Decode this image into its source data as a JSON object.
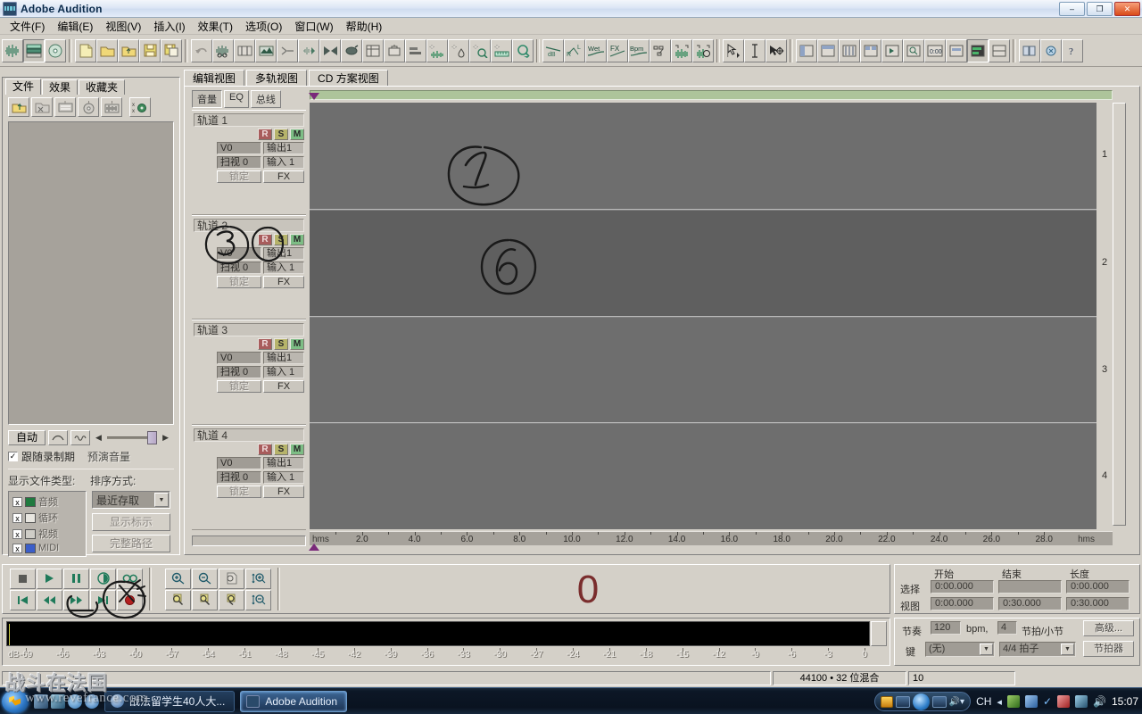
{
  "window": {
    "title": "Adobe Audition",
    "icon": "audition-icon",
    "minimize_label": "–",
    "maximize_label": "❐",
    "close_label": "✕"
  },
  "menubar": {
    "items": [
      {
        "label": "文件(F)",
        "name": "menu-file"
      },
      {
        "label": "编辑(E)",
        "name": "menu-edit"
      },
      {
        "label": "视图(V)",
        "name": "menu-view"
      },
      {
        "label": "插入(I)",
        "name": "menu-insert"
      },
      {
        "label": "效果(T)",
        "name": "menu-effects"
      },
      {
        "label": "选项(O)",
        "name": "menu-options"
      },
      {
        "label": "窗口(W)",
        "name": "menu-window"
      },
      {
        "label": "帮助(H)",
        "name": "menu-help"
      }
    ]
  },
  "toolbar": {
    "groups": [
      {
        "name": "view-mode",
        "buttons": [
          {
            "name": "edit-view-icon",
            "glyph": "wave"
          },
          {
            "name": "multitrack-view-icon",
            "glyph": "tracks",
            "pressed": true
          },
          {
            "name": "cd-view-icon",
            "glyph": "disc"
          }
        ]
      },
      {
        "name": "file-ops",
        "buttons": [
          {
            "name": "new-file-icon",
            "glyph": "page"
          },
          {
            "name": "open-file-icon",
            "glyph": "folder"
          },
          {
            "name": "save-as-icon",
            "glyph": "folder-up"
          },
          {
            "name": "save-icon",
            "glyph": "floppy"
          },
          {
            "name": "save-all-icon",
            "glyph": "floppy-plus"
          }
        ]
      },
      {
        "name": "edit-ops",
        "buttons": [
          {
            "name": "undo-icon",
            "glyph": "undo"
          },
          {
            "name": "cut-icon",
            "glyph": "scissors-wave"
          },
          {
            "name": "trim-icon",
            "glyph": "trim"
          },
          {
            "name": "mix-paste-icon",
            "glyph": "mixpaste"
          },
          {
            "name": "delete-silence-icon",
            "glyph": "cutmark"
          },
          {
            "name": "fade-icon",
            "glyph": "fade"
          },
          {
            "name": "reverse-icon",
            "glyph": "bowtie"
          },
          {
            "name": "normalize-icon",
            "glyph": "ellipse"
          },
          {
            "name": "group-waveform-icon",
            "glyph": "grid"
          },
          {
            "name": "envelope-icon",
            "glyph": "env"
          },
          {
            "name": "align-icon",
            "glyph": "align"
          }
        ]
      },
      {
        "name": "auto-ops",
        "buttons": [
          {
            "name": "auto-cue-icon",
            "glyph": "star-wave"
          },
          {
            "name": "auto-drop-icon",
            "glyph": "star-drop"
          },
          {
            "name": "auto-find-icon",
            "glyph": "star-find"
          },
          {
            "name": "auto-scale-icon",
            "glyph": "star-ruler"
          },
          {
            "name": "auto-scan-icon",
            "glyph": "magnify"
          }
        ]
      },
      {
        "name": "envelope-ops",
        "buttons": [
          {
            "name": "volume-envelope-icon",
            "glyph": "dB"
          },
          {
            "name": "pan-envelope-icon",
            "glyph": "RL"
          },
          {
            "name": "wet-envelope-icon",
            "glyph": "Wet"
          },
          {
            "name": "fx-envelope-icon",
            "glyph": "FX"
          },
          {
            "name": "tempo-envelope-icon",
            "glyph": "Bpm"
          }
        ]
      },
      {
        "name": "clip-ops",
        "buttons": [
          {
            "name": "clip-edge-icon",
            "glyph": "boxes"
          },
          {
            "name": "lock-time-icon",
            "glyph": "lock-wave"
          },
          {
            "name": "loop-clip-icon",
            "glyph": "loop-wave"
          }
        ]
      },
      {
        "name": "tools",
        "buttons": [
          {
            "name": "hybrid-tool-icon",
            "glyph": "arrow-i"
          },
          {
            "name": "time-select-tool-icon",
            "glyph": "ibeam"
          },
          {
            "name": "move-copy-tool-icon",
            "glyph": "move"
          }
        ]
      },
      {
        "name": "panels",
        "buttons": [
          {
            "name": "show-files-panel-icon",
            "glyph": "panel1"
          },
          {
            "name": "show-effects-panel-icon",
            "glyph": "panel2"
          },
          {
            "name": "show-mixer-panel-icon",
            "glyph": "panel3"
          },
          {
            "name": "show-organizer-icon",
            "glyph": "panel4"
          },
          {
            "name": "show-transport-icon",
            "glyph": "panel5"
          },
          {
            "name": "show-zoom-icon",
            "glyph": "panel6"
          },
          {
            "name": "show-time-icon",
            "glyph": "panel7"
          },
          {
            "name": "show-selection-icon",
            "glyph": "panel8"
          },
          {
            "name": "show-level-meters-icon",
            "glyph": "panel9",
            "pressed": true
          },
          {
            "name": "show-placekeeper-icon",
            "glyph": "panel10"
          }
        ]
      },
      {
        "name": "help",
        "buttons": [
          {
            "name": "workspace-icon",
            "glyph": "ws"
          },
          {
            "name": "about-icon",
            "glyph": "abt"
          },
          {
            "name": "help-icon",
            "glyph": "?"
          }
        ]
      }
    ]
  },
  "files_panel": {
    "tabs": [
      {
        "label": "文件",
        "name": "tab-files",
        "active": true
      },
      {
        "label": "效果",
        "name": "tab-effects",
        "active": false
      },
      {
        "label": "收藏夹",
        "name": "tab-favorites",
        "active": false
      }
    ],
    "toolbar_buttons": [
      {
        "name": "import-file-icon",
        "glyph": "import"
      },
      {
        "name": "close-file-icon",
        "glyph": "close-folder"
      },
      {
        "name": "insert-multitrack-icon",
        "glyph": "insert"
      },
      {
        "name": "insert-cd-icon",
        "glyph": "cd"
      },
      {
        "name": "edit-file-icon",
        "glyph": "edit-wave"
      },
      {
        "name": "file-options-icon",
        "glyph": "options"
      }
    ],
    "auto_button": "自动",
    "loop_button_name": "loop-play-button",
    "play_button_name": "play-preview-button",
    "preview_volume_label": "预演音量",
    "follow_record_label": "跟随录制期",
    "follow_record_checked": true,
    "show_types_label": "显示文件类型:",
    "sort_by_label": "排序方式:",
    "sort_value": "最近存取",
    "file_types": [
      {
        "label": "音频",
        "checked": true,
        "color": "#2fa84f",
        "name": "filetype-audio"
      },
      {
        "label": "循环",
        "checked": true,
        "color": "#e8e6e0",
        "name": "filetype-loop"
      },
      {
        "label": "视频",
        "checked": true,
        "color": "#cfcdc7",
        "name": "filetype-video"
      },
      {
        "label": "MIDI",
        "checked": true,
        "color": "#3b5ec9",
        "name": "filetype-midi"
      }
    ],
    "show_cues_button": "显示标示",
    "full_path_button": "完整路径"
  },
  "multitrack": {
    "tabs": [
      {
        "label": "编辑视图",
        "name": "tab-edit-view",
        "active": false
      },
      {
        "label": "多轨视图",
        "name": "tab-multitrack-view",
        "active": true
      },
      {
        "label": "CD 方案视图",
        "name": "tab-cd-view",
        "active": false
      }
    ],
    "view_buttons": [
      {
        "label": "音量",
        "name": "btn-volume-view",
        "pressed": true
      },
      {
        "label": "EQ",
        "name": "btn-eq-view",
        "pressed": false
      },
      {
        "label": "总线",
        "name": "btn-bus-view",
        "pressed": false
      }
    ],
    "track_control_labels": {
      "record": "R",
      "solo": "S",
      "mute": "M",
      "volume": "V0",
      "output": "输出1",
      "pan": "扫视 0",
      "input": "输入 1",
      "lock": "锁定",
      "fx": "FX"
    },
    "tracks": [
      {
        "name": "轨道 1",
        "number": "1"
      },
      {
        "name": "轨道 2",
        "number": "2"
      },
      {
        "name": "轨道 3",
        "number": "3"
      },
      {
        "name": "轨道 4",
        "number": "4"
      }
    ],
    "ruler": {
      "unit_left": "hms",
      "unit_right": "hms",
      "labels": [
        "2.0",
        "4.0",
        "6.0",
        "8.0",
        "10.0",
        "12.0",
        "14.0",
        "16.0",
        "18.0",
        "20.0",
        "22.0",
        "24.0",
        "26.0",
        "28.0"
      ]
    }
  },
  "transport": {
    "top_row": [
      {
        "name": "stop-button",
        "glyph": "stop"
      },
      {
        "name": "play-button",
        "glyph": "play"
      },
      {
        "name": "pause-button",
        "glyph": "pause"
      },
      {
        "name": "play-from-cursor-button",
        "glyph": "playcircle"
      },
      {
        "name": "loop-play-button",
        "glyph": "infinity"
      }
    ],
    "bottom_row": [
      {
        "name": "go-to-beginning-button",
        "glyph": "skipstart"
      },
      {
        "name": "rewind-button",
        "glyph": "rew"
      },
      {
        "name": "fast-forward-button",
        "glyph": "ff"
      },
      {
        "name": "go-to-end-button",
        "glyph": "skipend"
      },
      {
        "name": "record-button",
        "glyph": "record"
      }
    ],
    "zoom_top_row": [
      {
        "name": "zoom-in-horizontal-button",
        "glyph": "zoomin"
      },
      {
        "name": "zoom-out-horizontal-button",
        "glyph": "zoomout"
      },
      {
        "name": "zoom-out-full-button",
        "glyph": "zoomfull"
      },
      {
        "name": "zoom-in-vertical-button",
        "glyph": "vzoomin"
      }
    ],
    "zoom_bottom_row": [
      {
        "name": "zoom-to-selection-button",
        "glyph": "zsel"
      },
      {
        "name": "zoom-to-left-button",
        "glyph": "zleft"
      },
      {
        "name": "zoom-to-right-button",
        "glyph": "zright"
      },
      {
        "name": "zoom-out-vertical-button",
        "glyph": "vzoomout"
      }
    ],
    "time_display": "0"
  },
  "time_panel": {
    "headers": [
      "开始",
      "结束",
      "长度"
    ],
    "rows": [
      {
        "label": "选择",
        "start": "0:00.000",
        "end": "",
        "length": "0:00.000"
      },
      {
        "label": "视图",
        "start": "0:00.000",
        "end": "0:30.000",
        "length": "0:30.000"
      }
    ]
  },
  "tempo_panel": {
    "tempo_label": "节奏",
    "tempo_value": "120",
    "bpm_label": "bpm,",
    "beats_value": "4",
    "beats_label": "节拍/小节",
    "advanced_button": "高级...",
    "key_label": "键",
    "key_value": "(无)",
    "signature_value": "4/4 拍子",
    "metronome_button": "节拍器"
  },
  "level_meter": {
    "unit_label": "dB",
    "scale": [
      "-69",
      "-66",
      "-63",
      "-60",
      "-57",
      "-54",
      "-51",
      "-48",
      "-45",
      "-42",
      "-39",
      "-36",
      "-33",
      "-30",
      "-27",
      "-24",
      "-21",
      "-18",
      "-15",
      "-12",
      "-9",
      "-6",
      "-3",
      "0"
    ]
  },
  "statusbar": {
    "message": "",
    "format": "44100 • 32 位混合",
    "extra": "10"
  },
  "taskbar": {
    "start_name": "start-orb",
    "quicklaunch": [
      {
        "name": "show-desktop-icon"
      },
      {
        "name": "media-player-icon"
      },
      {
        "name": "messenger-icon"
      },
      {
        "name": "internet-explorer-icon"
      }
    ],
    "tasks": [
      {
        "label": "战法留学生40人大...",
        "name": "taskbar-item-browser",
        "active": false
      },
      {
        "label": "Adobe Audition",
        "name": "taskbar-item-audition",
        "active": true
      }
    ],
    "tray": {
      "ime_label": "CH",
      "clock": "15:07"
    }
  },
  "watermark": {
    "line1": "战斗在法国",
    "line2": "www.revefrance.com"
  },
  "annotations": [
    {
      "name": "annotation-circle-1",
      "text": "1",
      "target": "track1-clip-area"
    },
    {
      "name": "annotation-circle-3",
      "text": "3",
      "target": "track2-name"
    },
    {
      "name": "annotation-circle-6",
      "text": "6",
      "target": "track2-clip-area"
    },
    {
      "name": "annotation-circle-record-arm",
      "text": "",
      "target": "track2-record-button"
    },
    {
      "name": "annotation-circle-record-button",
      "text": "",
      "target": "transport-record-button"
    },
    {
      "name": "annotation-mark-fastforward",
      "text": "",
      "target": "transport-ff-button"
    }
  ],
  "colors": {
    "chrome": "#d4d0c8",
    "lane": "#6e6e6e",
    "lane_alt": "#5f5f5f",
    "scroll_green": "#adc49a",
    "record_red": "#a85c5c",
    "solo_yellow": "#b6b36a",
    "mute_green": "#7dbd85",
    "playhead": "#7a2a7a",
    "big_time": "#7a2d2d"
  }
}
